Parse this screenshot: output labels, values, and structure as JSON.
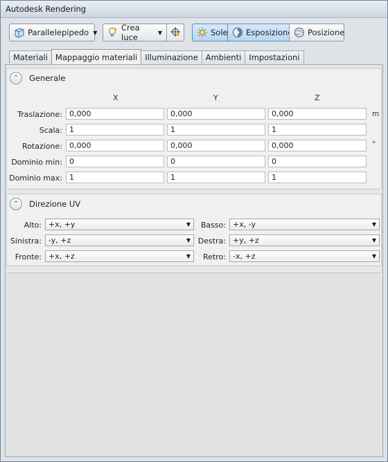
{
  "window": {
    "title": "Autodesk Rendering"
  },
  "toolbar": {
    "shape_label": "Parallelepipedo",
    "create_light_label": "Crea luce",
    "sun_label": "Sole",
    "exposure_label": "Esposizione",
    "position_label": "Posizione"
  },
  "tabs": [
    {
      "label": "Materiali"
    },
    {
      "label": "Mappaggio materiali"
    },
    {
      "label": "Illuminazione"
    },
    {
      "label": "Ambienti"
    },
    {
      "label": "Impostazioni"
    }
  ],
  "general": {
    "title": "Generale",
    "axes": [
      "X",
      "Y",
      "Z"
    ],
    "rows": [
      {
        "label": "Traslazione:",
        "x": "0,000",
        "y": "0,000",
        "z": "0,000",
        "unit": "m"
      },
      {
        "label": "Scala:",
        "x": "1",
        "y": "1",
        "z": "1",
        "unit": ""
      },
      {
        "label": "Rotazione:",
        "x": "0,000",
        "y": "0,000",
        "z": "0,000",
        "unit": "°"
      },
      {
        "label": "Dominio min:",
        "x": "0",
        "y": "0",
        "z": "0",
        "unit": ""
      },
      {
        "label": "Dominio max:",
        "x": "1",
        "y": "1",
        "z": "1",
        "unit": ""
      }
    ]
  },
  "uv": {
    "title": "Direzione UV",
    "left": [
      {
        "label": "Alto:",
        "value": "+x, +y"
      },
      {
        "label": "Sinistra:",
        "value": "-y, +z"
      },
      {
        "label": "Fronte:",
        "value": "+x, +z"
      }
    ],
    "right": [
      {
        "label": "Basso:",
        "value": "+x, -y"
      },
      {
        "label": "Destra:",
        "value": "+y, +z"
      },
      {
        "label": "Retro:",
        "value": "-x, +z"
      }
    ]
  }
}
